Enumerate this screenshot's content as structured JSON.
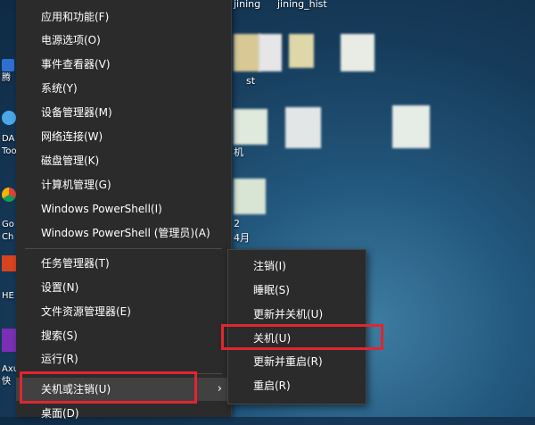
{
  "desktop": {
    "top_labels": [
      "jining",
      "jining_hist"
    ],
    "folder_label": "st",
    "tile_labels": [
      "机",
      "2",
      "4月"
    ],
    "left_labels": [
      "腾",
      "DA",
      "Too",
      "Go",
      "Ch",
      "HE",
      "Axu",
      "快"
    ]
  },
  "menu": {
    "items": [
      {
        "label": "应用和功能(F)"
      },
      {
        "label": "电源选项(O)"
      },
      {
        "label": "事件查看器(V)"
      },
      {
        "label": "系统(Y)"
      },
      {
        "label": "设备管理器(M)"
      },
      {
        "label": "网络连接(W)"
      },
      {
        "label": "磁盘管理(K)"
      },
      {
        "label": "计算机管理(G)"
      },
      {
        "label": "Windows PowerShell(I)"
      },
      {
        "label": "Windows PowerShell (管理员)(A)"
      },
      {
        "label": "任务管理器(T)"
      },
      {
        "label": "设置(N)"
      },
      {
        "label": "文件资源管理器(E)"
      },
      {
        "label": "搜索(S)"
      },
      {
        "label": "运行(R)"
      },
      {
        "label": "关机或注销(U)"
      },
      {
        "label": "桌面(D)"
      }
    ],
    "submenu_arrow": "›"
  },
  "submenu": {
    "items": [
      {
        "label": "注销(I)"
      },
      {
        "label": "睡眠(S)"
      },
      {
        "label": "更新并关机(U)"
      },
      {
        "label": "关机(U)"
      },
      {
        "label": "更新并重启(R)"
      },
      {
        "label": "重启(R)"
      }
    ]
  },
  "colors": {
    "menu_bg": "#2b2b2b",
    "highlight_box": "#e0262f",
    "text": "#ffffff"
  }
}
